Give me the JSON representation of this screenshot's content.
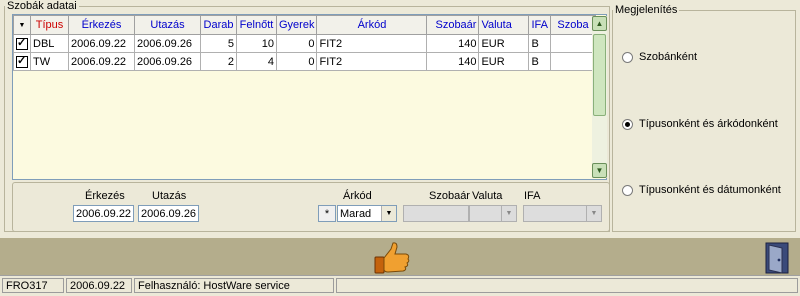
{
  "rooms_group": {
    "title": "Szobák adatai"
  },
  "grid": {
    "columns": [
      "Típus",
      "Érkezés",
      "Utazás",
      "Darab",
      "Felnőtt",
      "Gyerek",
      "Árkód",
      "Szobaár",
      "Valuta",
      "IFA",
      "Szoba"
    ],
    "rows": [
      [
        "DBL",
        "2006.09.22",
        "2006.09.26",
        "5",
        "10",
        "0",
        "FIT2",
        "140",
        "EUR",
        "B",
        ""
      ],
      [
        "TW",
        "2006.09.22",
        "2006.09.26",
        "2",
        "4",
        "0",
        "FIT2",
        "140",
        "EUR",
        "B",
        ""
      ]
    ]
  },
  "edit": {
    "arrival_label": "Érkezés",
    "arrival_value": "2006.09.22",
    "departure_label": "Utazás",
    "departure_value": "2006.09.26",
    "rate_code_label": "Árkód",
    "rate_code_star": "*",
    "rate_code_value": "Marad",
    "room_rate_label": "Szobaár",
    "currency_label": "Valuta",
    "ifa_label": "IFA"
  },
  "display_group": {
    "title": "Megjelenítés",
    "options": [
      {
        "label": "Szobánként",
        "selected": false
      },
      {
        "label": "Típusonként és árkódonként",
        "selected": true
      },
      {
        "label": "Típusonként és dátumonként",
        "selected": false
      }
    ]
  },
  "statusbar": {
    "code": "FRO317",
    "date": "2006.09.22",
    "user": "Felhasználó: HostWare service"
  },
  "icons": {
    "ok": "thumbs-up-icon",
    "exit": "exit-door-icon"
  }
}
